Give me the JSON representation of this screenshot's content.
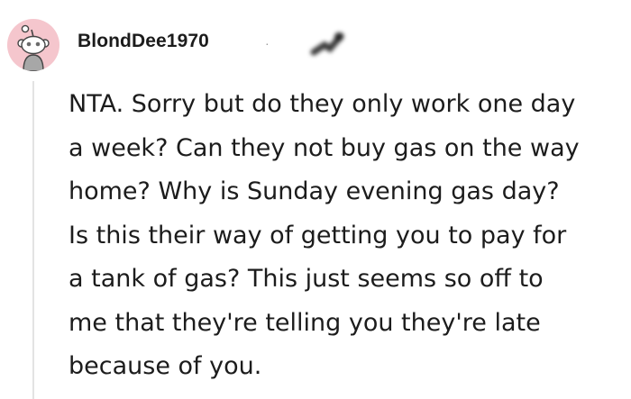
{
  "comment": {
    "author": "BlondDee1970",
    "separator": "·",
    "body_lines": [
      "NTA. Sorry but do they only work one day",
      "a week? Can they not buy gas on the way",
      "home? Why is Sunday evening gas day?",
      "Is this their way of getting you to pay for",
      "a tank of gas? This just seems so off to",
      "me that they're telling you they're late",
      "because of you."
    ]
  },
  "icons": {
    "avatar": "reddit-snoo-avatar-icon",
    "blurred": "blurred-award-icon"
  },
  "colors": {
    "avatar_bg": "#f5c6cd",
    "text": "#1c1c1c",
    "thread_line": "#e3e3e3"
  }
}
